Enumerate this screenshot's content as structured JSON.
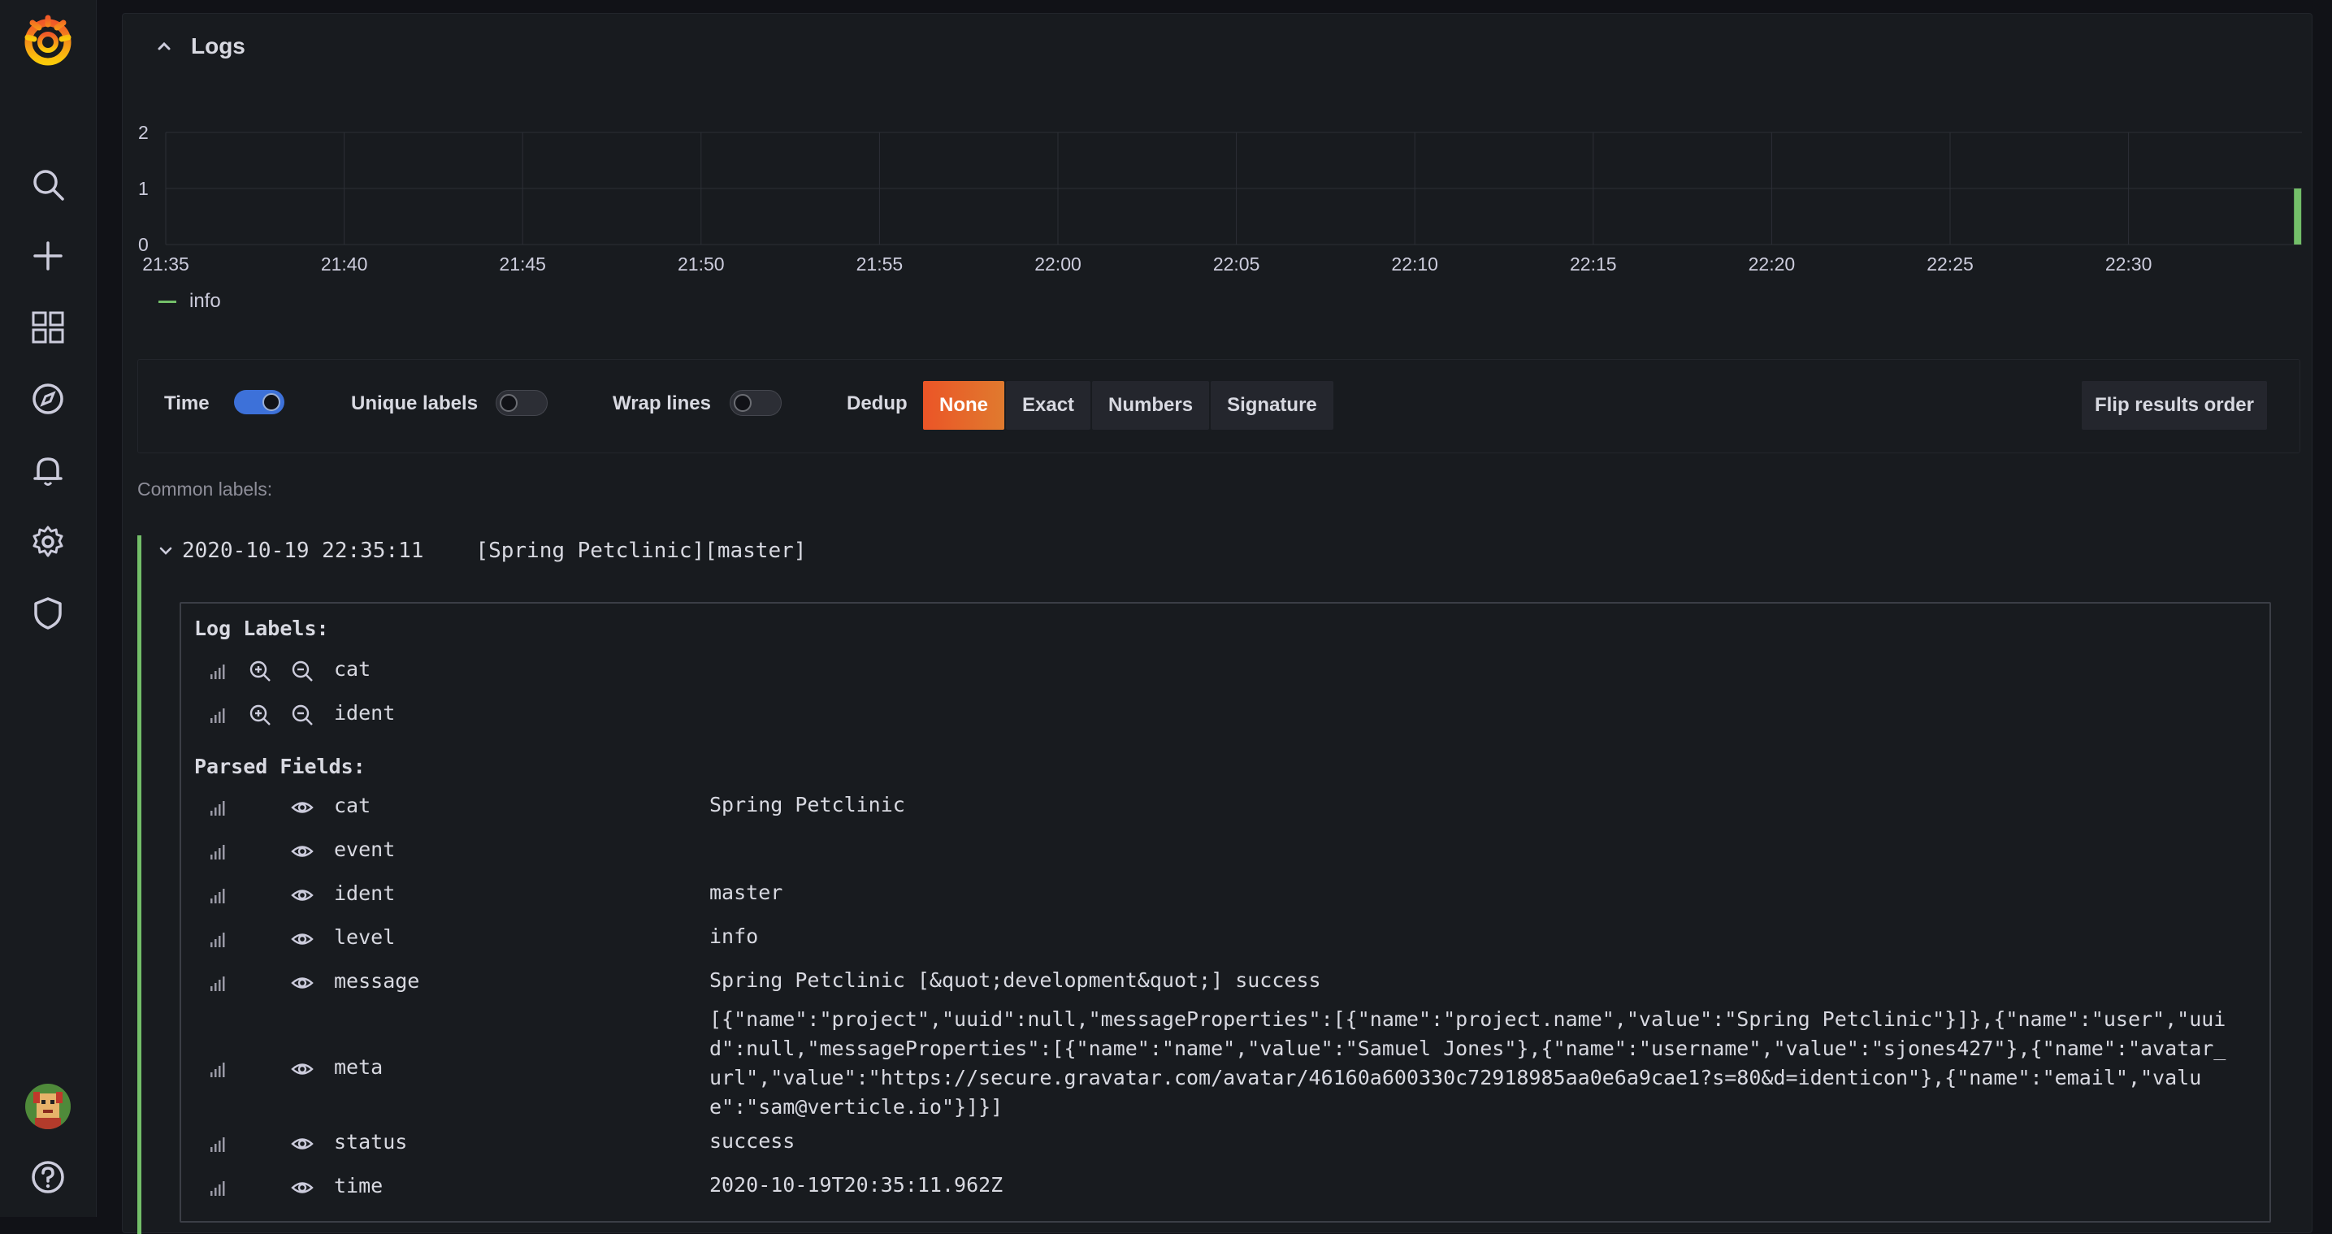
{
  "panel": {
    "title": "Logs"
  },
  "sidebar": {
    "icons": [
      "grafana-logo",
      "search-icon",
      "plus-icon",
      "dashboards-icon",
      "explore-icon",
      "alerting-icon",
      "settings-icon",
      "shield-icon",
      "avatar",
      "help-icon"
    ]
  },
  "chart_data": {
    "type": "bar",
    "x_ticks": [
      "21:35",
      "21:40",
      "21:45",
      "21:50",
      "21:55",
      "22:00",
      "22:05",
      "22:10",
      "22:15",
      "22:20",
      "22:25",
      "22:30"
    ],
    "y_ticks": [
      "0",
      "1",
      "2"
    ],
    "ylim": [
      0,
      2
    ],
    "series": [
      {
        "name": "info",
        "color": "#73bf69",
        "points": [
          {
            "x": "22:35",
            "y": 1
          }
        ]
      }
    ],
    "legend": "bottom-left",
    "grid": true
  },
  "controls": {
    "time_label": "Time",
    "time_on": true,
    "unique_labels_label": "Unique labels",
    "unique_labels_on": false,
    "wrap_lines_label": "Wrap lines",
    "wrap_lines_on": false,
    "dedup_label": "Dedup",
    "dedup_options": [
      "None",
      "Exact",
      "Numbers",
      "Signature"
    ],
    "dedup_selected": "None",
    "flip_label": "Flip results order"
  },
  "common_labels": "Common labels:",
  "log": {
    "timestamp": "2020-10-19 22:35:11",
    "message": "[Spring Petclinic][master]",
    "log_labels_title": "Log Labels:",
    "log_labels": [
      "cat",
      "ident"
    ],
    "parsed_fields_title": "Parsed Fields:",
    "parsed_fields": [
      {
        "name": "cat",
        "value": "Spring Petclinic"
      },
      {
        "name": "event",
        "value": ""
      },
      {
        "name": "ident",
        "value": "master"
      },
      {
        "name": "level",
        "value": "info"
      },
      {
        "name": "message",
        "value": "Spring Petclinic [&quot;development&quot;] success"
      },
      {
        "name": "meta",
        "value": "[{\"name\":\"project\",\"uuid\":null,\"messageProperties\":[{\"name\":\"project.name\",\"value\":\"Spring Petclinic\"}]},{\"name\":\"user\",\"uuid\":null,\"messageProperties\":[{\"name\":\"name\",\"value\":\"Samuel Jones\"},{\"name\":\"username\",\"value\":\"sjones427\"},{\"name\":\"avatar_url\",\"value\":\"https://secure.gravatar.com/avatar/46160a600330c72918985aa0e6a9cae1?s=80&d=identicon\"},{\"name\":\"email\",\"value\":\"sam@verticle.io\"}]}]"
      },
      {
        "name": "status",
        "value": "success"
      },
      {
        "name": "time",
        "value": "2020-10-19T20:35:11.962Z"
      }
    ]
  }
}
